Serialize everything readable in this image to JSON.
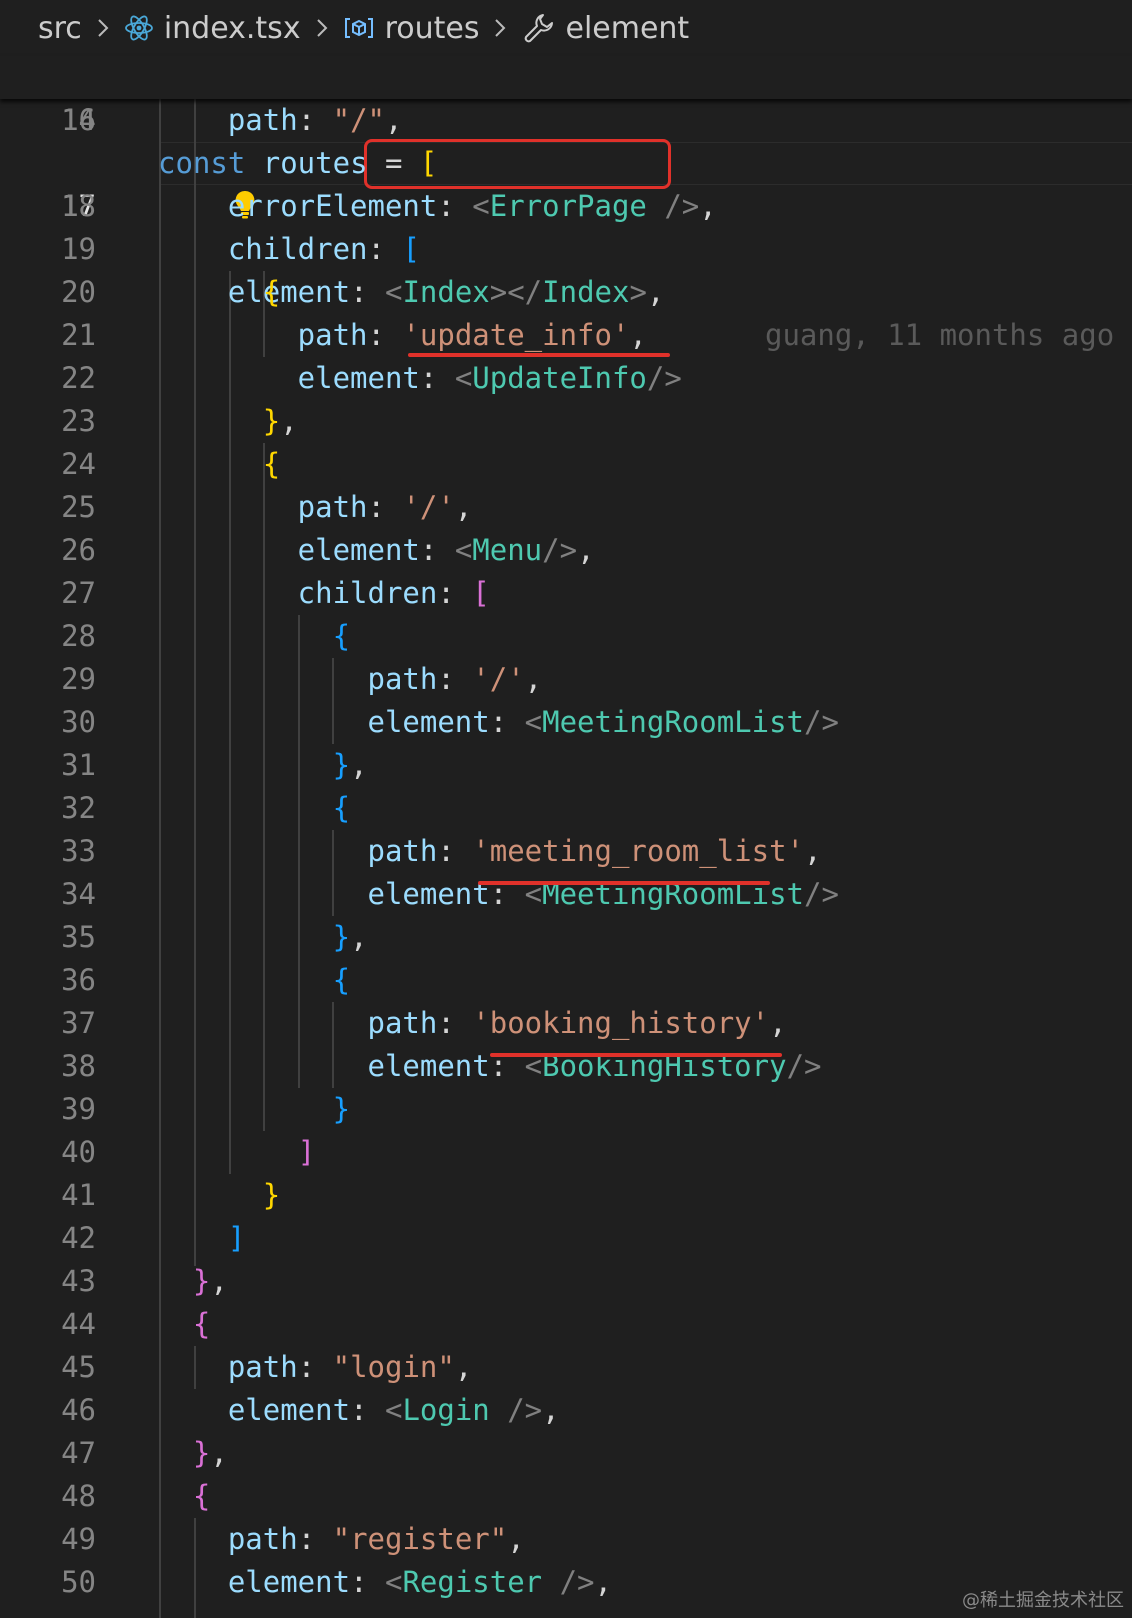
{
  "breadcrumb": {
    "items": [
      {
        "label": "src",
        "icon": ""
      },
      {
        "label": "index.tsx",
        "icon": "react-icon"
      },
      {
        "label": "routes",
        "icon": "variable-icon"
      },
      {
        "label": "element",
        "icon": "wrench-icon"
      }
    ]
  },
  "editor": {
    "active_line": "17",
    "blame": "guang, 11 months ago",
    "watermark": "@稀土掘金技术社区",
    "lines": [
      {
        "n": "14",
        "tokens": [
          {
            "t": "const ",
            "c": "k"
          },
          {
            "t": "routes",
            "c": "v"
          },
          {
            "t": " = ",
            "c": "o"
          },
          {
            "t": "[",
            "c": "b1"
          }
        ]
      },
      {
        "n": "16",
        "tokens": [
          {
            "t": "    path",
            "c": "v"
          },
          {
            "t": ": ",
            "c": "o"
          },
          {
            "t": "\"/\"",
            "c": "s"
          },
          {
            "t": ",",
            "c": "o"
          }
        ]
      },
      {
        "n": "17",
        "tokens": [
          {
            "t": "    element",
            "c": "v"
          },
          {
            "t": ": ",
            "c": "o"
          },
          {
            "t": "<",
            "c": "g"
          },
          {
            "t": "Index",
            "c": "t"
          },
          {
            "t": "></",
            "c": "g"
          },
          {
            "t": "Index",
            "c": "t"
          },
          {
            "t": ">",
            "c": "g"
          },
          {
            "t": ",",
            "c": "o"
          }
        ]
      },
      {
        "n": "18",
        "tokens": [
          {
            "t": "    errorElement",
            "c": "v"
          },
          {
            "t": ": ",
            "c": "o"
          },
          {
            "t": "<",
            "c": "g"
          },
          {
            "t": "ErrorPage",
            "c": "t"
          },
          {
            "t": " />",
            "c": "g"
          },
          {
            "t": ",",
            "c": "o"
          }
        ]
      },
      {
        "n": "19",
        "tokens": [
          {
            "t": "    children",
            "c": "v"
          },
          {
            "t": ": ",
            "c": "o"
          },
          {
            "t": "[",
            "c": "b3"
          }
        ]
      },
      {
        "n": "20",
        "tokens": [
          {
            "t": "      ",
            "c": "o"
          },
          {
            "t": "{",
            "c": "b1"
          }
        ]
      },
      {
        "n": "21",
        "tokens": [
          {
            "t": "        path",
            "c": "v"
          },
          {
            "t": ": ",
            "c": "o"
          },
          {
            "t": "'update_info'",
            "c": "s"
          },
          {
            "t": ",",
            "c": "o"
          }
        ]
      },
      {
        "n": "22",
        "tokens": [
          {
            "t": "        element",
            "c": "v"
          },
          {
            "t": ": ",
            "c": "o"
          },
          {
            "t": "<",
            "c": "g"
          },
          {
            "t": "UpdateInfo",
            "c": "t"
          },
          {
            "t": "/>",
            "c": "g"
          }
        ]
      },
      {
        "n": "23",
        "tokens": [
          {
            "t": "      ",
            "c": "o"
          },
          {
            "t": "}",
            "c": "b1"
          },
          {
            "t": ",",
            "c": "o"
          }
        ]
      },
      {
        "n": "24",
        "tokens": [
          {
            "t": "      ",
            "c": "o"
          },
          {
            "t": "{",
            "c": "b1"
          }
        ]
      },
      {
        "n": "25",
        "tokens": [
          {
            "t": "        path",
            "c": "v"
          },
          {
            "t": ": ",
            "c": "o"
          },
          {
            "t": "'/'",
            "c": "s"
          },
          {
            "t": ",",
            "c": "o"
          }
        ]
      },
      {
        "n": "26",
        "tokens": [
          {
            "t": "        element",
            "c": "v"
          },
          {
            "t": ": ",
            "c": "o"
          },
          {
            "t": "<",
            "c": "g"
          },
          {
            "t": "Menu",
            "c": "t"
          },
          {
            "t": "/>",
            "c": "g"
          },
          {
            "t": ",",
            "c": "o"
          }
        ]
      },
      {
        "n": "27",
        "tokens": [
          {
            "t": "        children",
            "c": "v"
          },
          {
            "t": ": ",
            "c": "o"
          },
          {
            "t": "[",
            "c": "b2"
          }
        ]
      },
      {
        "n": "28",
        "tokens": [
          {
            "t": "          ",
            "c": "o"
          },
          {
            "t": "{",
            "c": "b3"
          }
        ]
      },
      {
        "n": "29",
        "tokens": [
          {
            "t": "            path",
            "c": "v"
          },
          {
            "t": ": ",
            "c": "o"
          },
          {
            "t": "'/'",
            "c": "s"
          },
          {
            "t": ",",
            "c": "o"
          }
        ]
      },
      {
        "n": "30",
        "tokens": [
          {
            "t": "            element",
            "c": "v"
          },
          {
            "t": ": ",
            "c": "o"
          },
          {
            "t": "<",
            "c": "g"
          },
          {
            "t": "MeetingRoomList",
            "c": "t"
          },
          {
            "t": "/>",
            "c": "g"
          }
        ]
      },
      {
        "n": "31",
        "tokens": [
          {
            "t": "          ",
            "c": "o"
          },
          {
            "t": "}",
            "c": "b3"
          },
          {
            "t": ",",
            "c": "o"
          }
        ]
      },
      {
        "n": "32",
        "tokens": [
          {
            "t": "          ",
            "c": "o"
          },
          {
            "t": "{",
            "c": "b3"
          }
        ]
      },
      {
        "n": "33",
        "tokens": [
          {
            "t": "            path",
            "c": "v"
          },
          {
            "t": ": ",
            "c": "o"
          },
          {
            "t": "'meeting_room_list'",
            "c": "s"
          },
          {
            "t": ",",
            "c": "o"
          }
        ]
      },
      {
        "n": "34",
        "tokens": [
          {
            "t": "            element",
            "c": "v"
          },
          {
            "t": ": ",
            "c": "o"
          },
          {
            "t": "<",
            "c": "g"
          },
          {
            "t": "MeetingRoomList",
            "c": "t"
          },
          {
            "t": "/>",
            "c": "g"
          }
        ]
      },
      {
        "n": "35",
        "tokens": [
          {
            "t": "          ",
            "c": "o"
          },
          {
            "t": "}",
            "c": "b3"
          },
          {
            "t": ",",
            "c": "o"
          }
        ]
      },
      {
        "n": "36",
        "tokens": [
          {
            "t": "          ",
            "c": "o"
          },
          {
            "t": "{",
            "c": "b3"
          }
        ]
      },
      {
        "n": "37",
        "tokens": [
          {
            "t": "            path",
            "c": "v"
          },
          {
            "t": ": ",
            "c": "o"
          },
          {
            "t": "'booking_history'",
            "c": "s"
          },
          {
            "t": ",",
            "c": "o"
          }
        ]
      },
      {
        "n": "38",
        "tokens": [
          {
            "t": "            element",
            "c": "v"
          },
          {
            "t": ": ",
            "c": "o"
          },
          {
            "t": "<",
            "c": "g"
          },
          {
            "t": "BookingHistory",
            "c": "t"
          },
          {
            "t": "/>",
            "c": "g"
          }
        ]
      },
      {
        "n": "39",
        "tokens": [
          {
            "t": "          ",
            "c": "o"
          },
          {
            "t": "}",
            "c": "b3"
          }
        ]
      },
      {
        "n": "40",
        "tokens": [
          {
            "t": "        ",
            "c": "o"
          },
          {
            "t": "]",
            "c": "b2"
          }
        ]
      },
      {
        "n": "41",
        "tokens": [
          {
            "t": "      ",
            "c": "o"
          },
          {
            "t": "}",
            "c": "b1"
          }
        ]
      },
      {
        "n": "42",
        "tokens": [
          {
            "t": "    ",
            "c": "o"
          },
          {
            "t": "]",
            "c": "b3"
          }
        ]
      },
      {
        "n": "43",
        "tokens": [
          {
            "t": "  ",
            "c": "o"
          },
          {
            "t": "}",
            "c": "b2"
          },
          {
            "t": ",",
            "c": "o"
          }
        ]
      },
      {
        "n": "44",
        "tokens": [
          {
            "t": "  ",
            "c": "o"
          },
          {
            "t": "{",
            "c": "b2"
          }
        ]
      },
      {
        "n": "45",
        "tokens": [
          {
            "t": "    path",
            "c": "v"
          },
          {
            "t": ": ",
            "c": "o"
          },
          {
            "t": "\"login\"",
            "c": "s"
          },
          {
            "t": ",",
            "c": "o"
          }
        ]
      },
      {
        "n": "46",
        "tokens": [
          {
            "t": "    element",
            "c": "v"
          },
          {
            "t": ": ",
            "c": "o"
          },
          {
            "t": "<",
            "c": "g"
          },
          {
            "t": "Login",
            "c": "t"
          },
          {
            "t": " />",
            "c": "g"
          },
          {
            "t": ",",
            "c": "o"
          }
        ]
      },
      {
        "n": "47",
        "tokens": [
          {
            "t": "  ",
            "c": "o"
          },
          {
            "t": "}",
            "c": "b2"
          },
          {
            "t": ",",
            "c": "o"
          }
        ]
      },
      {
        "n": "48",
        "tokens": [
          {
            "t": "  ",
            "c": "o"
          },
          {
            "t": "{",
            "c": "b2"
          }
        ]
      },
      {
        "n": "49",
        "tokens": [
          {
            "t": "    path",
            "c": "v"
          },
          {
            "t": ": ",
            "c": "o"
          },
          {
            "t": "\"register\"",
            "c": "s"
          },
          {
            "t": ",",
            "c": "o"
          }
        ]
      },
      {
        "n": "50",
        "tokens": [
          {
            "t": "    element",
            "c": "v"
          },
          {
            "t": ": ",
            "c": "o"
          },
          {
            "t": "<",
            "c": "g"
          },
          {
            "t": "Register",
            "c": "t"
          },
          {
            "t": " />",
            "c": "g"
          },
          {
            "t": ",",
            "c": "o"
          }
        ]
      }
    ]
  },
  "colors": {
    "background": "#1f1f1f",
    "keyword": "#569cd6",
    "property": "#9cdcfe",
    "string": "#ce9178",
    "component": "#4ec9b0",
    "bracket_gold": "#ffd700",
    "bracket_pink": "#da70d6",
    "bracket_blue": "#179fff",
    "annotation_red": "#e0312a"
  }
}
